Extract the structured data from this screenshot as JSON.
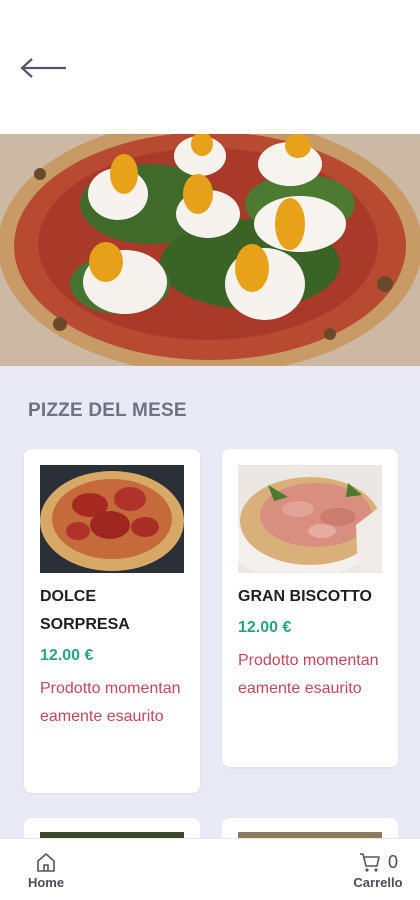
{
  "header": {
    "back_icon": "arrow-left-icon"
  },
  "hero": {
    "image": "pizza-burrata-rucola-photo"
  },
  "section": {
    "title": "PIZZE DEL MESE"
  },
  "products": [
    {
      "name": "DOLCE SORPRESA",
      "price": "12.00 €",
      "status": "Prodotto momentaneamente esaurito",
      "image": "pizza-dolce-sorpresa-photo"
    },
    {
      "name": "GRAN BISCOTTO",
      "price": "12.00 €",
      "status": "Prodotto momentaneamente esaurito",
      "image": "pizza-gran-biscotto-photo"
    }
  ],
  "bottom_nav": {
    "home_label": "Home",
    "home_icon": "home-icon",
    "cart_label": "Carrello",
    "cart_icon": "cart-icon",
    "cart_count": "0"
  },
  "colors": {
    "background": "#e9eaf5",
    "price": "#2aa37e",
    "status": "#c0485a",
    "section_title": "#6f7184"
  }
}
